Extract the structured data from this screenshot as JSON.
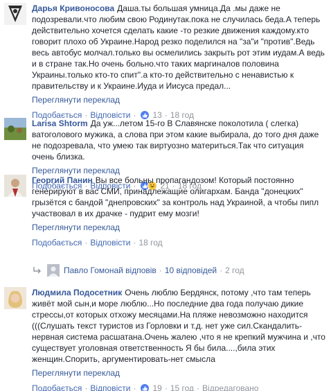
{
  "comments": [
    {
      "author": "Дарья Кривоносова",
      "text": "Даша.ты большая умница.Да .мы даже не подозревали.что любим свою Родинутак.пока не случилась беда.А теперь действительно хочется сделать какие -то резкие движения каждому.кто говорит плохо об Украине.Народ резко поделился на \"за\"и \"против\".Ведь весь автобус молчал.только вы осмелились закрыть рот этим иудам.А ведь и в стране так.Но очень больно.что таких маргиналов половина Украины.только кто-то спит\".а кто-то действительно с ненавистью к правительству и к Украине.Иуда и Иисуса предал...",
      "translate": "Переглянути переклад",
      "like": "Подобається",
      "reply": "Відповісти",
      "reactions_count": "13",
      "time": "18 год"
    },
    {
      "author": "Larisa Shtorm",
      "text": "Да уж...летом 15-го В Славянске поколотила ( слегка) ватоголового мужика, а слова при этом какие выбирала, до того дня даже не подозревала, что умею так виртуозно материться.Так что ситуация очень близка.",
      "translate": "Переглянути переклад",
      "like": "Подобається",
      "reply": "Відповісти",
      "reactions_count": "21",
      "time": "18 год"
    },
    {
      "author": "Георгий Панин",
      "text": "Вы все больны пропагандозом! Который постоянно генерируют в вас СМИ, принадлежащие олигархам. Банда \"донецких\" грызётся с бандой \"днепровских\" за контроль над Украиной, а чтобы пипл участвовал в их драчке - пудрит ему мозги!",
      "translate": "Переглянути переклад",
      "like": "Подобається",
      "reply": "Відповісти",
      "time": "18 год"
    },
    {
      "author": "Людмила Подосетник",
      "text": "Очень люблю Бердянск, потому ,что там теперь живёт мой сын,и море люблю...Но последние два года получаю дикие стрессы,от которых отхожу месяцами.На пляже невозможно находится (((Слушать текст туристов из Горловки и т.д. нет уже сил.Скандалить-нервная система расшатана.Очень жалею ,что я не крепкий мужчина и ,что существует уголовная ответственность Я бы била....,била этих женщин.Спорить, аргументировать-нет смысла",
      "translate": "Переглянути переклад",
      "like": "Подобається",
      "reply": "Відповісти",
      "reactions_count": "19",
      "time": "15 год",
      "edited": "Відредаговано"
    }
  ],
  "reply_thread": {
    "name": "Павло Гомонай відповів",
    "count": "10 відповідей",
    "time": "2 год"
  }
}
